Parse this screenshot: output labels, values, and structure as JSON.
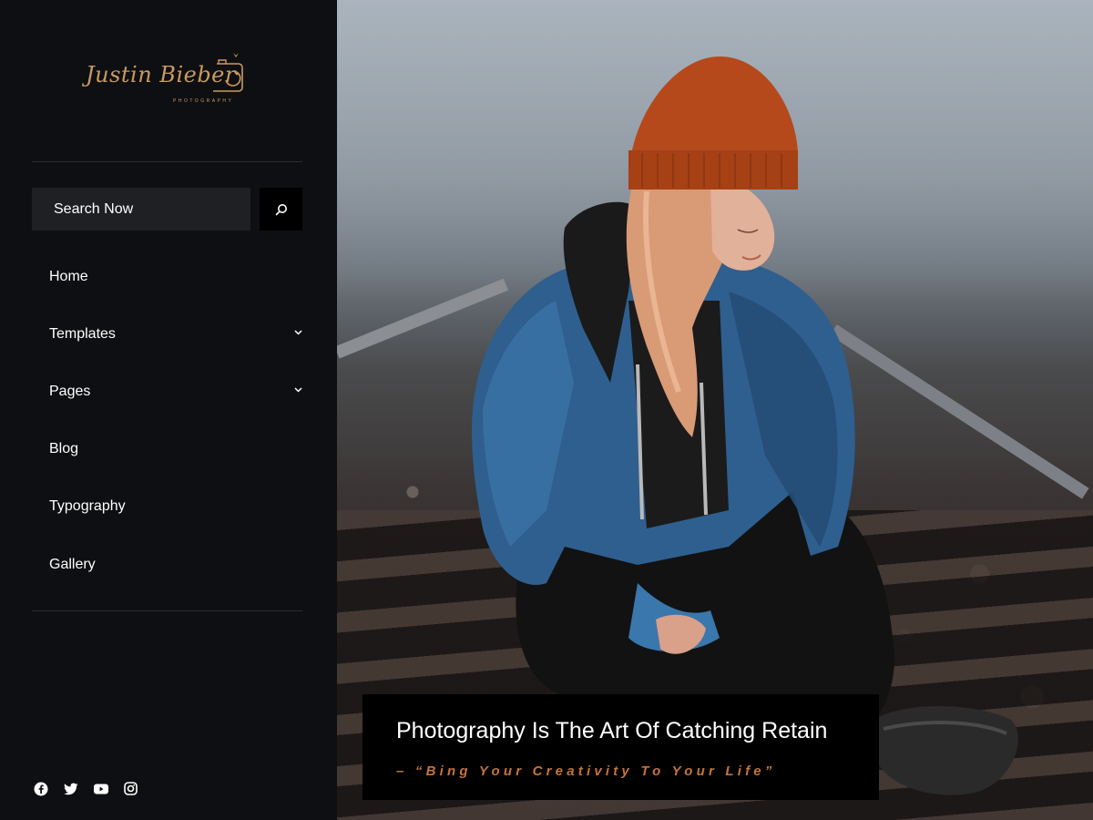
{
  "brand": {
    "logo_script": "Justin Bieber",
    "logo_sub": "PHOTOGRAPHY",
    "accent": "#c99a5f"
  },
  "search": {
    "placeholder": "Search Now",
    "button_icon": "search-icon"
  },
  "nav": {
    "items": [
      {
        "label": "Home"
      },
      {
        "label": "Templates",
        "icon": "chevron-down-icon"
      },
      {
        "label": "Pages",
        "icon": "chevron-down-icon"
      },
      {
        "label": "Blog"
      },
      {
        "label": "Typography"
      },
      {
        "label": "Gallery"
      }
    ]
  },
  "social": [
    "facebook-icon",
    "twitter-icon",
    "youtube-icon",
    "instagram-icon"
  ],
  "hero": {
    "title": "Photography Is The Art Of Catching Retain",
    "quote": "– “Bing Your Creativity To Your Life”",
    "quote_color": "#c3733d"
  }
}
